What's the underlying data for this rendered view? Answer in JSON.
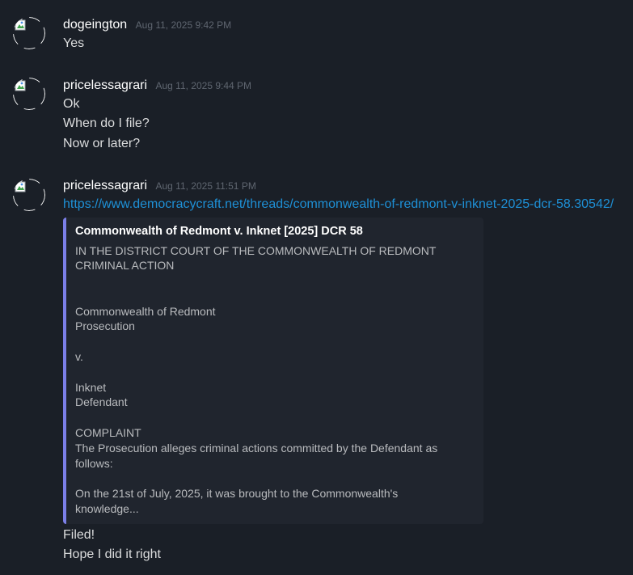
{
  "messages": [
    {
      "username": "dogeington",
      "timestamp": "Aug 11, 2025 9:42 PM",
      "lines": [
        "Yes"
      ]
    },
    {
      "username": "pricelessagrari",
      "timestamp": "Aug 11, 2025 9:44 PM",
      "lines": [
        "Ok",
        "When do I file?",
        "Now or later?"
      ]
    },
    {
      "username": "pricelessagrari",
      "timestamp": "Aug 11, 2025 11:51 PM",
      "link": "https://www.democracycraft.net/threads/commonwealth-of-redmont-v-inknet-2025-dcr-58.30542/",
      "embed": {
        "title": "Commonwealth of Redmont v. Inknet [2025] DCR 58",
        "lines": [
          "IN THE DISTRICT COURT OF THE COMMONWEALTH OF REDMONT",
          "CRIMINAL ACTION",
          "Commonwealth of Redmont",
          "Prosecution",
          "v.",
          "Inknet",
          "Defendant",
          "COMPLAINT",
          "The Prosecution alleges criminal actions committed by the Defendant as",
          "follows:",
          "On the 21st of July, 2025, it was brought to the Commonwealth's",
          "knowledge..."
        ],
        "accent_color": "#7b7fe8"
      },
      "after_lines": [
        "Filed!",
        "Hope I did it right"
      ]
    }
  ],
  "icons": {
    "avatar": "broken-image-avatar-icon"
  },
  "colors": {
    "background": "#1a1f27",
    "embed_background": "#20252e",
    "link": "#1e90d6",
    "username": "#ffffff",
    "timestamp": "#5f6670"
  }
}
